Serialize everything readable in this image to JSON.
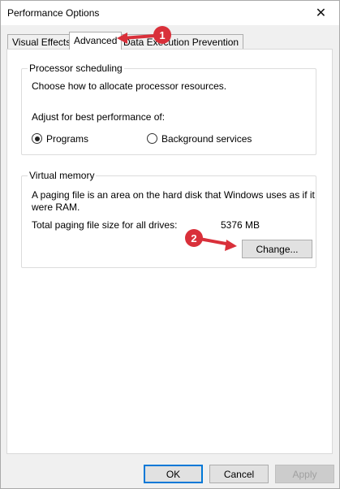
{
  "window": {
    "title": "Performance Options",
    "close_glyph": "✕"
  },
  "tabs": [
    {
      "label": "Visual Effects"
    },
    {
      "label": "Advanced",
      "selected": true
    },
    {
      "label": "Data Execution Prevention"
    }
  ],
  "processor": {
    "group_label": "Processor scheduling",
    "description": "Choose how to allocate processor resources.",
    "adjust_label": "Adjust for best performance of:",
    "options": [
      {
        "label": "Programs",
        "selected": true
      },
      {
        "label": "Background services",
        "selected": false
      }
    ]
  },
  "virtual_memory": {
    "group_label": "Virtual memory",
    "description_line1": "A paging file is an area on the hard disk that Windows uses as if it",
    "description_line2": "were RAM.",
    "total_label": "Total paging file size for all drives:",
    "total_value": "5376 MB",
    "change_button": "Change..."
  },
  "footer": {
    "ok": "OK",
    "cancel": "Cancel",
    "apply": "Apply"
  },
  "annotations": {
    "step1": "1",
    "step2": "2",
    "color": "#d9303a"
  }
}
